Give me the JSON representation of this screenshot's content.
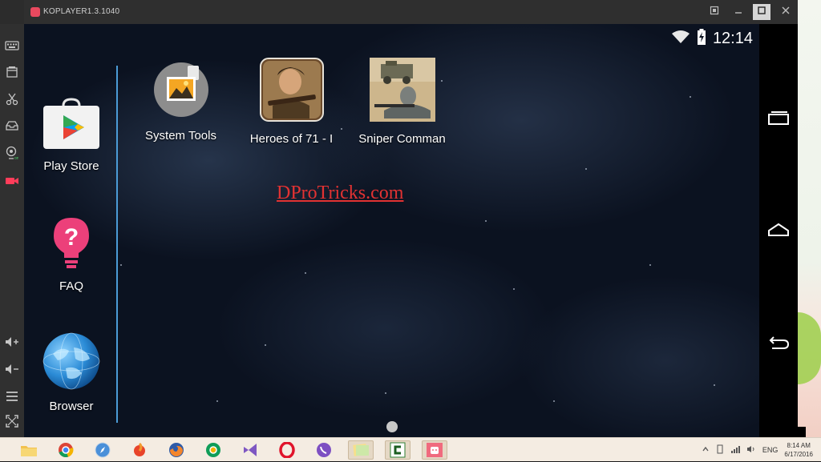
{
  "window": {
    "title": "KOPLAYER1.3.1040",
    "controls": [
      "screenshot",
      "minimize",
      "maximize",
      "close"
    ]
  },
  "toolbar": {
    "tools": [
      {
        "name": "keyboard-icon"
      },
      {
        "name": "apk-install-icon"
      },
      {
        "name": "scissors-icon"
      },
      {
        "name": "inbox-icon"
      },
      {
        "name": "webcam-icon"
      },
      {
        "name": "record-video-icon"
      },
      {
        "name": "volume-up-icon"
      },
      {
        "name": "volume-down-icon"
      },
      {
        "name": "menu-icon"
      },
      {
        "name": "fullscreen-icon"
      }
    ]
  },
  "android": {
    "status": {
      "time": "12:14"
    },
    "dock": [
      {
        "label": "Play Store",
        "icon": "play-store-icon"
      },
      {
        "label": "FAQ",
        "icon": "faq-icon"
      },
      {
        "label": "Browser",
        "icon": "browser-icon"
      }
    ],
    "apps": [
      {
        "label": "System Tools",
        "icon": "system-tools-icon"
      },
      {
        "label": "Heroes of 71 - I",
        "icon": "heroes-of-71-icon"
      },
      {
        "label": "Sniper Comman",
        "icon": "sniper-commando-icon"
      }
    ],
    "watermark": "DProTricks.com"
  },
  "taskbar": {
    "tray": {
      "lang": "ENG",
      "time": "8:14 AM",
      "date": "6/17/2016"
    }
  },
  "colors": {
    "accent": "#4b9bd6",
    "watermark": "#e23232",
    "record": "#ff3d5a"
  }
}
